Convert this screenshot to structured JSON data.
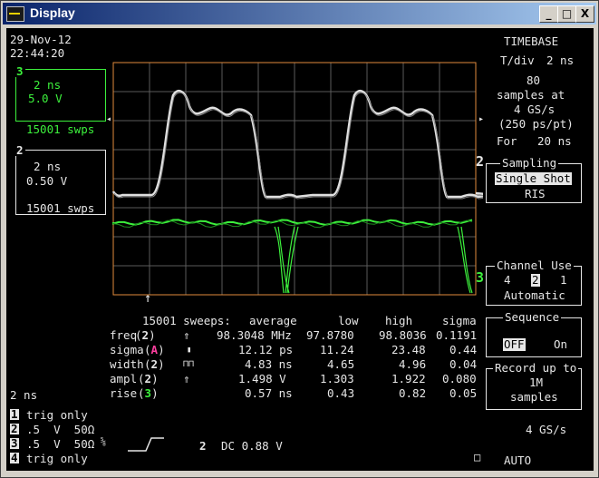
{
  "window": {
    "title": "Display",
    "buttons": {
      "minimize": "_",
      "maximize": "□",
      "close": "X"
    }
  },
  "datetime": {
    "date": "29-Nov-12",
    "time": "22:44:20"
  },
  "channels": {
    "ch3": {
      "number": "3",
      "timediv": "2 ns",
      "voltdiv": "5.0 V",
      "sweeps": "15001 swps"
    },
    "ch2": {
      "number": "2",
      "timediv": "2 ns",
      "voltdiv": "0.50 V",
      "sweeps": "15001 swps"
    }
  },
  "timebase": {
    "header": "TIMEBASE",
    "tdiv_label": "T/div",
    "tdiv_value": "2 ns",
    "samples_count": "80",
    "samples_at": "samples at",
    "rate": "4 GS/s",
    "ps_per_pt": "(250 ps/pt)",
    "for_label": "For",
    "for_value": "20 ns"
  },
  "sampling": {
    "title": "Sampling",
    "options": [
      "Single Shot",
      "RIS"
    ],
    "selected": "Single Shot"
  },
  "channel_use": {
    "title": "Channel Use",
    "options": [
      "4",
      "2",
      "1"
    ],
    "selected": "2",
    "mode": "Automatic"
  },
  "sequence": {
    "title": "Sequence",
    "options": [
      "OFF",
      "On"
    ],
    "selected": "OFF"
  },
  "record": {
    "line1": "Record up to",
    "line2": "1M",
    "line3": "samples"
  },
  "trace_markers": {
    "upper": "2",
    "lower": "3",
    "trigger_arrow": "↑"
  },
  "stats": {
    "header": [
      "15001 sweeps:",
      "average",
      "low",
      "high",
      "sigma"
    ],
    "rows": [
      {
        "name": "freq",
        "ch": "2",
        "sym": "⇑",
        "average": "98.3048 MHz",
        "low": "97.8780",
        "high": "98.8036",
        "sigma": "0.1191"
      },
      {
        "name": "sigma",
        "ch": "A",
        "sym": "▮",
        "average": "12.12 ps",
        "low": "11.24",
        "high": "23.48",
        "sigma": "0.44"
      },
      {
        "name": "width",
        "ch": "2",
        "sym": "⊓⊓",
        "average": "4.83 ns",
        "low": "4.65",
        "high": "4.96",
        "sigma": "0.04"
      },
      {
        "name": "ampl",
        "ch": "2",
        "sym": "⇑",
        "average": "1.498 V",
        "low": "1.303",
        "high": "1.922",
        "sigma": "0.080"
      },
      {
        "name": "rise",
        "ch": "3",
        "sym": "",
        "average": "0.57 ns",
        "low": "0.43",
        "high": "0.82",
        "sigma": "0.05"
      }
    ]
  },
  "bottom": {
    "timediv": "2 ns",
    "ch1": {
      "num": "1",
      "text": "trig only"
    },
    "ch2": {
      "num": "2",
      "text": ".5  V  50Ω"
    },
    "ch3": {
      "num": "3",
      "text": ".5  V  50Ω"
    },
    "ch3_suffix": "⅝",
    "ch4": {
      "num": "4",
      "text": "trig only"
    },
    "trigger": {
      "num": "2",
      "text": "DC 0.88 V"
    },
    "rate": "4 GS/s",
    "mode": "AUTO"
  },
  "colors": {
    "trace_white": "#e0e0e0",
    "trace_green": "#3cf03c",
    "grid_border": "#e08a3c",
    "titlebar": "#0a246a"
  }
}
